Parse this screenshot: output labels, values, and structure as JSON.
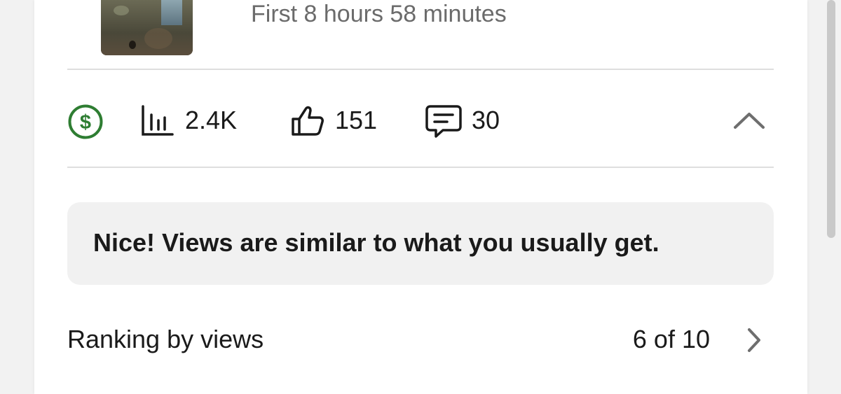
{
  "post": {
    "subtitle": "First 8 hours 58 minutes"
  },
  "stats": {
    "views": "2.4K",
    "likes": "151",
    "comments": "30",
    "monetization_color": "#2e7d32"
  },
  "icons": {
    "monetization": "dollar-circle-icon",
    "views": "bar-chart-icon",
    "likes": "thumbs-up-icon",
    "comments": "comment-icon",
    "collapse": "chevron-up-icon",
    "ranking": "chevron-right-icon"
  },
  "insight": {
    "message": "Nice! Views are similar to what you usually get."
  },
  "ranking": {
    "label": "Ranking by views",
    "value": "6 of 10"
  }
}
